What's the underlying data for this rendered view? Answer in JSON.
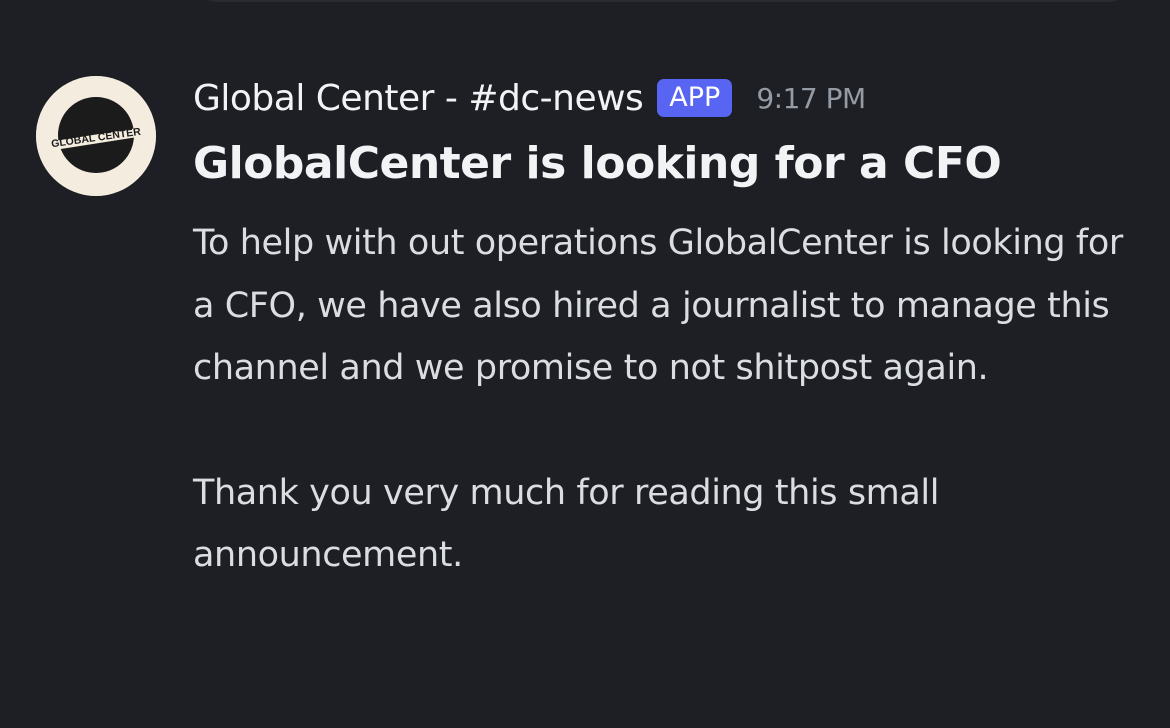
{
  "message": {
    "author": "Global Center - #dc-news",
    "badge": "APP",
    "timestamp": "9:17 PM",
    "avatar": {
      "icon": "global-center-logo",
      "text": "GLOBAL CENTER",
      "colors": {
        "background": "#f4ecdf",
        "disc": "#1b1b1b"
      }
    },
    "title": "GlobalCenter is looking for a CFO",
    "paragraphs": [
      "To help with out operations GlobalCenter is looking for a CFO, we have also hired a journalist to manage this channel and we promise to not shitpost again.",
      "Thank you very much for reading this small announcement."
    ]
  },
  "colors": {
    "background": "#1e1f24",
    "accent": "#5865f2",
    "text_primary": "#f2f3f5",
    "text_body": "#dbdee1",
    "text_muted": "#949ba4"
  }
}
